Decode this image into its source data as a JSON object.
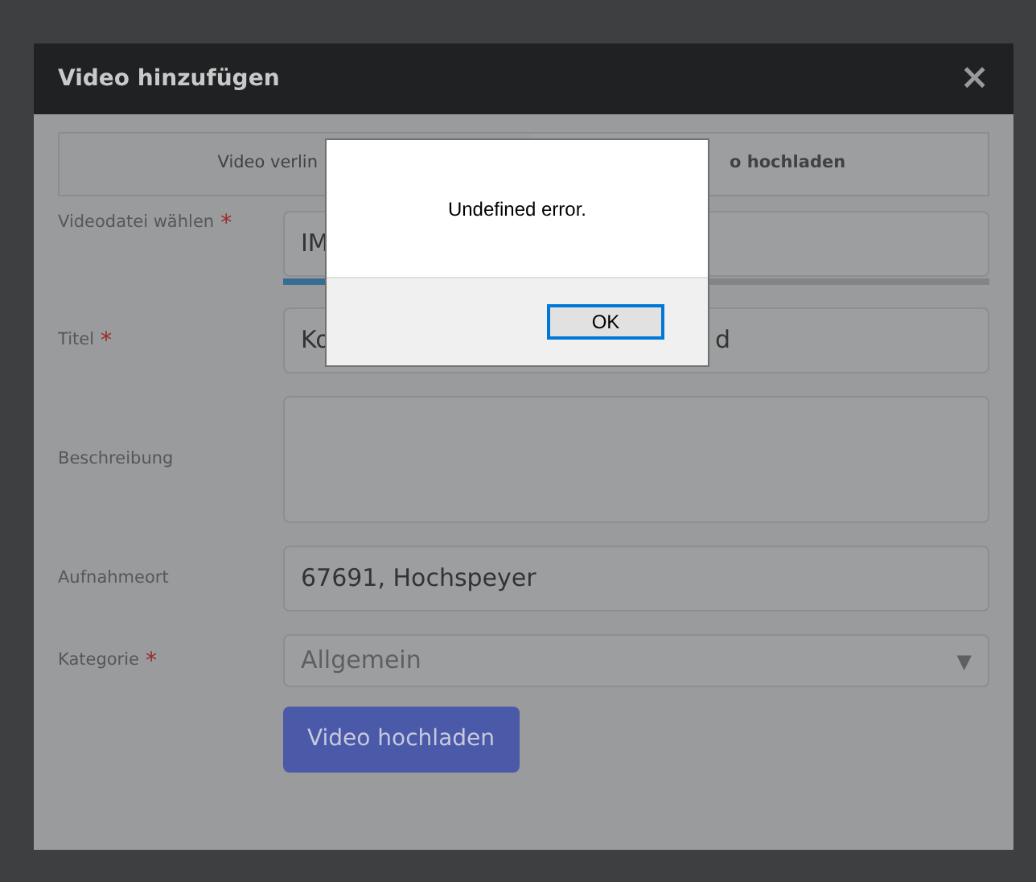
{
  "modal": {
    "title": "Video hinzufügen",
    "close": "×"
  },
  "tabs": [
    {
      "label": "Video verlin",
      "selected": false
    },
    {
      "label": "o hochladen",
      "selected": true
    }
  ],
  "fields": [
    {
      "kind": "file",
      "label": "Videodatei wählen",
      "required_mark": "*",
      "value": "IM",
      "level": 0.3
    },
    {
      "kind": "text",
      "label": "Titel",
      "required_mark": "*",
      "value": "Ko",
      "value_end": "d"
    },
    {
      "kind": "textarea",
      "label": "Beschreibung"
    },
    {
      "kind": "text",
      "label": "Aufnahmeort",
      "value": "67691, Hochspeyer"
    },
    {
      "kind": "select",
      "label": "Kategorie",
      "required_mark": "*",
      "value": "Allgemein",
      "arrow": "▼"
    }
  ],
  "submit": "Video hochladen",
  "alert": {
    "message": "Undefined error.",
    "button": "OK"
  }
}
